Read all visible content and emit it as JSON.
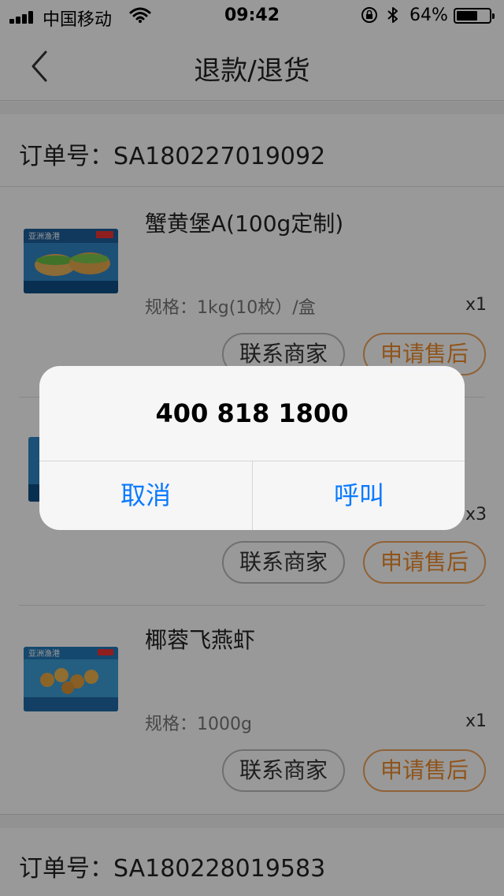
{
  "status_bar": {
    "carrier": "中国移动",
    "time": "09:42",
    "battery_percent": "64%",
    "battery_level": 0.64
  },
  "nav": {
    "title": "退款/退货"
  },
  "orders": [
    {
      "order_label": "订单号：SA180227019092",
      "items": [
        {
          "name": "蟹黄堡A(100g定制)",
          "spec": "规格：1kg(10枚）/盒",
          "qty": "x1",
          "contact_label": "联系商家",
          "apply_label": "申请售后"
        },
        {
          "name": "",
          "spec": "",
          "qty": "x3",
          "contact_label": "联系商家",
          "apply_label": "申请售后"
        },
        {
          "name": "椰蓉飞燕虾",
          "spec": "规格：1000g",
          "qty": "x1",
          "contact_label": "联系商家",
          "apply_label": "申请售后"
        }
      ]
    },
    {
      "order_label": "订单号：SA180228019583"
    }
  ],
  "dialog": {
    "phone_number": "400 818 1800",
    "cancel_label": "取消",
    "call_label": "呼叫"
  },
  "colors": {
    "accent_orange": "#ef8c2e",
    "ios_blue": "#0a7aff",
    "overlay": "rgba(0,0,0,0.40)"
  },
  "icons": {
    "back": "chevron-left-icon",
    "wifi": "wifi-icon",
    "lock": "orientation-lock-icon",
    "bluetooth": "bluetooth-icon",
    "battery": "battery-icon",
    "signal": "signal-bars-icon"
  }
}
